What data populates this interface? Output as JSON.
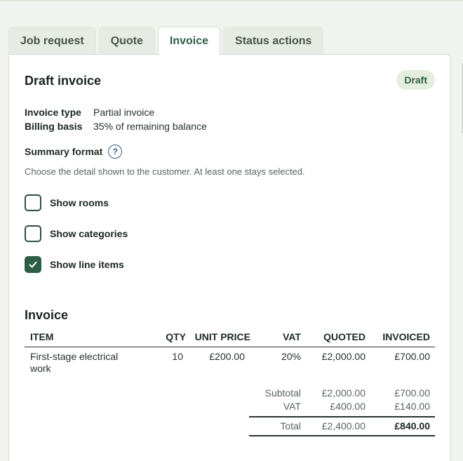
{
  "tabs": [
    "Job request",
    "Quote",
    "Invoice",
    "Status actions"
  ],
  "active_tab": "Invoice",
  "panel": {
    "title": "Draft invoice",
    "badge": "Draft"
  },
  "meta": {
    "type_label": "Invoice type",
    "type_value": "Partial invoice",
    "basis_label": "Billing basis",
    "basis_value": "35% of remaining balance"
  },
  "summary": {
    "label": "Summary format",
    "help": "?",
    "hint": "Choose the detail shown to the customer. At least one stays selected.",
    "options": [
      {
        "label": "Show rooms",
        "checked": false
      },
      {
        "label": "Show categories",
        "checked": false
      },
      {
        "label": "Show line items",
        "checked": true
      }
    ]
  },
  "invoice": {
    "title": "Invoice",
    "headers": {
      "item": "ITEM",
      "qty": "QTY",
      "unit": "UNIT PRICE",
      "vat": "VAT",
      "quoted": "QUOTED",
      "invoiced": "INVOICED"
    },
    "rows": [
      {
        "item_line1": "First-stage electrical",
        "item_line2": "work",
        "qty": "10",
        "unit": "£200.00",
        "vat": "20%",
        "quoted": "£2,000.00",
        "invoiced": "£700.00"
      }
    ],
    "totals": {
      "subtotal_label": "Subtotal",
      "subtotal_quoted": "£2,000.00",
      "subtotal_invoiced": "£700.00",
      "vat_label": "VAT",
      "vat_quoted": "£400.00",
      "vat_invoiced": "£140.00",
      "total_label": "Total",
      "total_quoted": "£2,400.00",
      "total_invoiced": "£840.00"
    }
  }
}
